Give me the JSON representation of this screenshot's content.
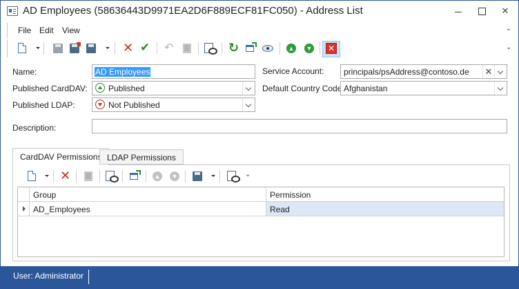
{
  "window": {
    "title": "AD Employees (58636443D9971EA2D6F889ECF81FC050) - Address List"
  },
  "menu": {
    "items": [
      "File",
      "Edit",
      "View"
    ]
  },
  "toolbar_icons": [
    "new-icon",
    "save-icon",
    "save-close-icon",
    "save-new-icon",
    "delete-icon",
    "apply-icon",
    "undo-icon",
    "report-icon",
    "preview-icon",
    "refresh-icon",
    "new-window-icon",
    "view-icon",
    "move-up-icon",
    "move-down-icon",
    "close-window-icon"
  ],
  "form": {
    "name_label": "Name:",
    "name_value": "AD Employees",
    "published_carddav_label": "Published CardDAV:",
    "published_carddav_value": "Published",
    "published_ldap_label": "Published LDAP:",
    "published_ldap_value": "Not Published",
    "description_label": "Description:",
    "description_value": "",
    "service_account_label": "Service Account:",
    "service_account_value": "principals/psAddress@contoso.de",
    "default_country_label": "Default Country Code:",
    "default_country_value": "Afghanistan"
  },
  "tabs": [
    {
      "label": "CardDAV Permissions",
      "active": true
    },
    {
      "label": "LDAP Permissions",
      "active": false
    }
  ],
  "grid": {
    "columns": [
      "Group",
      "Permission"
    ],
    "rows": [
      {
        "group": "AD_Employees",
        "permission": "Read"
      }
    ]
  },
  "status": {
    "user": "User: Administrator"
  },
  "colors": {
    "accent": "#2b579a",
    "selection": "#3399ff",
    "row_selected": "#dce8f5"
  }
}
